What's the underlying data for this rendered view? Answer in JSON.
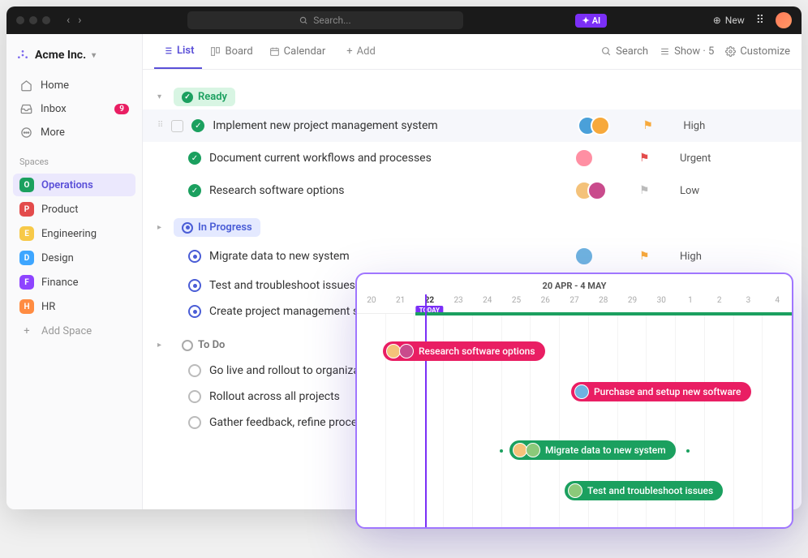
{
  "titlebar": {
    "searchPlaceholder": "Search...",
    "aiLabel": "AI",
    "newLabel": "New"
  },
  "workspace": {
    "name": "Acme Inc."
  },
  "nav": {
    "home": "Home",
    "inbox": "Inbox",
    "inboxCount": "9",
    "more": "More"
  },
  "spacesHeader": "Spaces",
  "spaces": [
    {
      "letter": "O",
      "name": "Operations",
      "color": "#1ba05f",
      "active": true
    },
    {
      "letter": "P",
      "name": "Product",
      "color": "#e34b4b"
    },
    {
      "letter": "E",
      "name": "Engineering",
      "color": "#f7c948"
    },
    {
      "letter": "D",
      "name": "Design",
      "color": "#3ea6ff"
    },
    {
      "letter": "F",
      "name": "Finance",
      "color": "#8e44ff"
    },
    {
      "letter": "H",
      "name": "HR",
      "color": "#ff8c42"
    }
  ],
  "addSpace": "Add Space",
  "views": {
    "list": "List",
    "board": "Board",
    "calendar": "Calendar",
    "add": "Add"
  },
  "toolbarRight": {
    "search": "Search",
    "show": "Show · 5",
    "customize": "Customize"
  },
  "statuses": {
    "ready": "Ready",
    "inProgress": "In Progress",
    "todo": "To Do"
  },
  "groups": {
    "ready": [
      {
        "title": "Implement new project management system",
        "priority": "High",
        "flagColor": "#f7a93b",
        "avatars": [
          "#4aa0d9",
          "#f7a93b"
        ]
      },
      {
        "title": "Document current workflows and processes",
        "priority": "Urgent",
        "flagColor": "#e34b4b",
        "avatars": [
          "#ff8fa3"
        ]
      },
      {
        "title": "Research software options",
        "priority": "Low",
        "flagColor": "#bbbbbb",
        "avatars": [
          "#f4c27a",
          "#c94b8c"
        ]
      }
    ],
    "inProgress": [
      {
        "title": "Migrate data to new system",
        "priority": "High",
        "flagColor": "#f7a93b",
        "avatars": [
          "#6fb3e0"
        ]
      },
      {
        "title": "Test and troubleshoot issues"
      },
      {
        "title": "Create project management stand"
      }
    ],
    "todo": [
      {
        "title": "Go live and rollout to organization"
      },
      {
        "title": "Rollout across all projects"
      },
      {
        "title": "Gather feedback, refine process"
      }
    ]
  },
  "timeline": {
    "range": "20 APR - 4 MAY",
    "todayLabel": "TODAY",
    "dates": [
      "20",
      "21",
      "22",
      "23",
      "24",
      "25",
      "26",
      "27",
      "28",
      "29",
      "30",
      "1",
      "2",
      "3",
      "4"
    ],
    "bars": {
      "research": "Research software options",
      "purchase": "Purchase and setup new software",
      "migrate": "Migrate data to new system",
      "test": "Test and troubleshoot issues"
    }
  }
}
